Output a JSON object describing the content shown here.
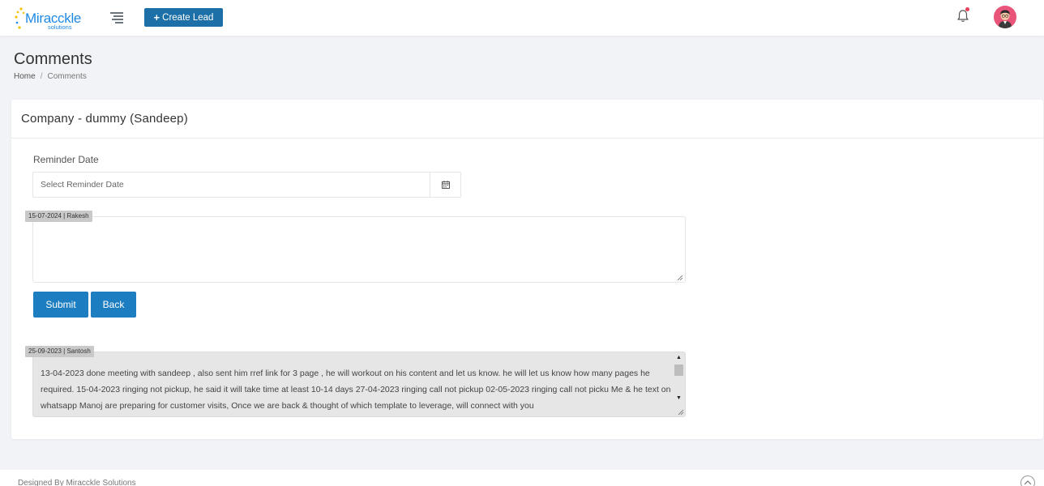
{
  "brand": {
    "name": "Miracckle",
    "tagline": "solutions",
    "colors": {
      "primary": "#1e88e5",
      "star": "#f4c20d"
    }
  },
  "topbar": {
    "menu_icon": "hamburger-icon",
    "create_lead_label": "Create Lead",
    "create_lead_icon": "plus-icon",
    "notification_icon": "bell-icon",
    "avatar_icon": "user-avatar"
  },
  "page": {
    "title": "Comments",
    "breadcrumb": {
      "home": "Home",
      "separator": "/",
      "current": "Comments"
    }
  },
  "card": {
    "title": "Company - dummy (Sandeep)",
    "reminder_label": "Reminder Date",
    "reminder_placeholder": "Select Reminder Date",
    "calendar_icon": "calendar-icon",
    "new_comment_meta": "15-07-2024 | Rakesh",
    "new_comment_value": "",
    "submit_label": "Submit",
    "back_label": "Back",
    "history": [
      {
        "meta": "25-09-2023 | Santosh",
        "text": "13-04-2023 done meeting with sandeep , also sent him rref link for 3 page , he will workout on his content and let us know. he will let us know how many pages he required. 15-04-2023 ringing not pickup, he said it will take time at least 10-14 days 27-04-2023 ringing call not pickup 02-05-2023 ringing call not picku Me & he text on whatsapp Manoj are preparing for customer visits, Once we are back & thought of which template to leverage, will connect with you"
      }
    ]
  },
  "footer": {
    "text": "Designed By Miracckle Solutions",
    "back_to_top_icon": "chevron-up-icon"
  },
  "colors": {
    "button": "#1d7dc1",
    "create_lead": "#1d6fa8",
    "notification_dot": "#e83e5b",
    "meta_tag": "#c9c9c9",
    "page_bg": "#f1f3f7"
  }
}
